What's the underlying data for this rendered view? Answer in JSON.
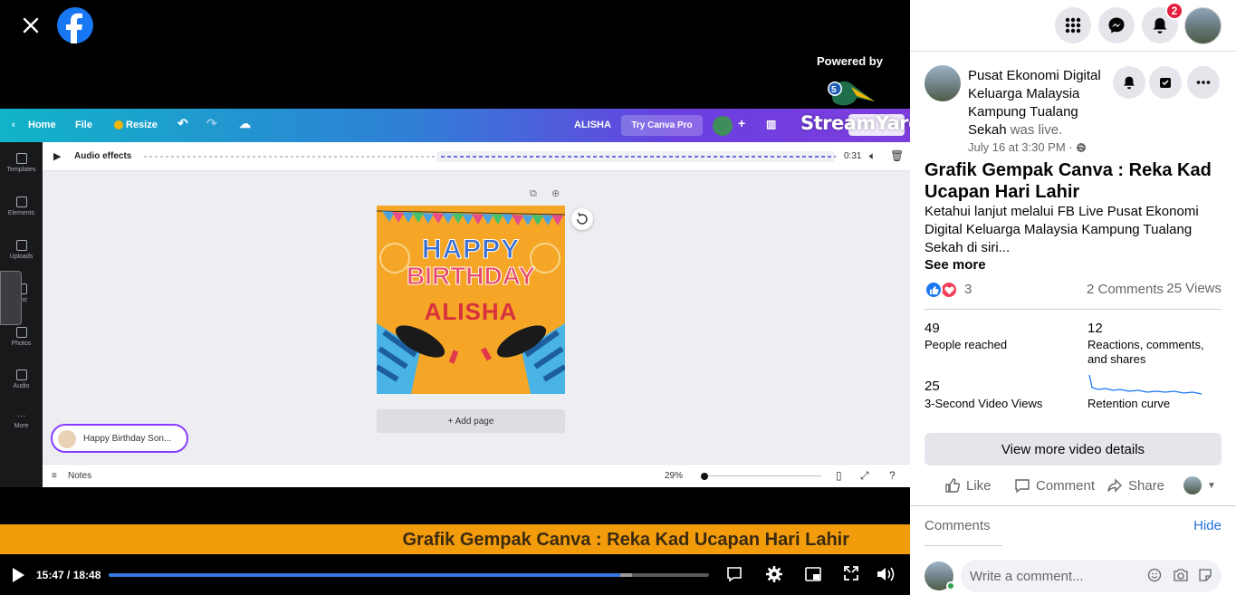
{
  "video": {
    "powered_by": "Powered by",
    "streamyard": "StreamYard",
    "lower_third": "Grafik Gempak Canva : Reka Kad Ucapan Hari Lahir",
    "time_display": "15:47 / 18:48",
    "progress_fraction": 0.852
  },
  "canva": {
    "home": "Home",
    "file": "File",
    "resize": "Resize",
    "doc_name": "ALISHA",
    "try_pro": "Try Canva Pro",
    "audio_effects": "Audio effects",
    "audio_time": "0:31",
    "sidebar": [
      "Templates",
      "Elements",
      "Uploads",
      "Text",
      "Photos",
      "Audio",
      "More"
    ],
    "card_line1": "HAPPY",
    "card_line2": "BIRTHDAY",
    "card_line3": "ALISHA",
    "add_page": "+ Add page",
    "song": "Happy Birthday Son...",
    "notes": "Notes",
    "zoom": "29%"
  },
  "header": {
    "notification_count": "2"
  },
  "post": {
    "page_name": "Pusat Ekonomi Digital Keluarga Malaysia Kampung Tualang Sekah",
    "was_live": " was live.",
    "time": "July 16 at 3:30 PM · ",
    "title": "Grafik Gempak Canva : Reka Kad Ucapan Hari Lahir",
    "description": "Ketahui lanjut melalui FB Live Pusat Ekonomi Digital Keluarga Malaysia Kampung Tualang Sekah di siri...",
    "see_more": "See more",
    "reaction_count": "3",
    "comments_count": "2 Comments",
    "views_count": "25 Views"
  },
  "stats": [
    {
      "value": "49",
      "label": "People reached"
    },
    {
      "value": "12",
      "label": "Reactions, comments, and shares"
    },
    {
      "value": "25",
      "label": "3-Second Video Views"
    },
    {
      "value": "",
      "label": "Retention curve"
    }
  ],
  "actions": {
    "more_details": "View more video details",
    "like": "Like",
    "comment": "Comment",
    "share": "Share"
  },
  "comments": {
    "label": "Comments",
    "hide": "Hide",
    "placeholder": "Write a comment..."
  },
  "colors": {
    "accent": "#1877f2",
    "lower_third": "#f39c0b",
    "progress": "#3578e5"
  }
}
